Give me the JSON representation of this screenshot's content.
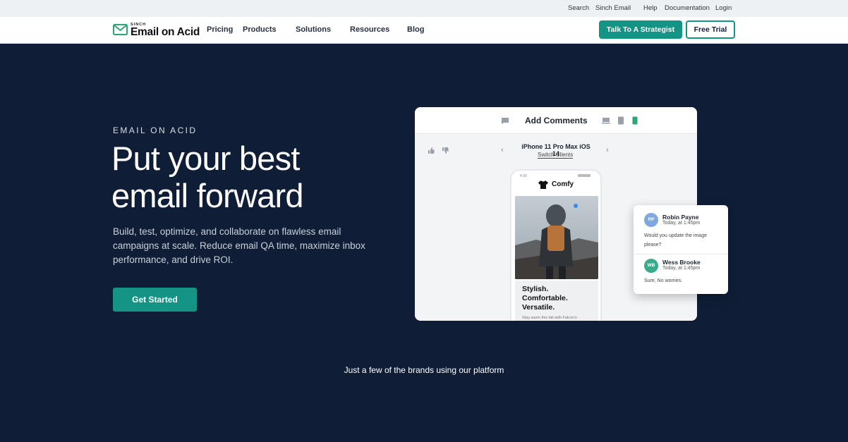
{
  "topbar": {
    "links": [
      "Search",
      "Sinch Email",
      "Help",
      "Documentation",
      "Login"
    ]
  },
  "nav": {
    "logo_small": "SINCH",
    "logo_text": "Email on Acid",
    "items": [
      "Pricing",
      "Products",
      "Solutions",
      "Resources",
      "Blog"
    ],
    "cta_primary": "Talk To A Strategist",
    "cta_secondary": "Free Trial"
  },
  "hero": {
    "eyebrow": "EMAIL ON ACID",
    "headline_line1": "Put your best",
    "headline_line2": "email forward",
    "subtext": "Build, test, optimize, and collaborate on flawless email campaigns at scale. Reduce email QA time, maximize inbox performance, and drive ROI.",
    "cta": "Get Started"
  },
  "mockup": {
    "title": "Add Comments",
    "device": "iPhone 11 Pro Max iOS 14",
    "switch_label": "Switch Clients",
    "phone": {
      "time": "4:30",
      "brand": "Comfy",
      "tagline": [
        "Stylish.",
        "Comfortable.",
        "Versatile."
      ],
      "fine_print": "Stay warm this fall with Falcon's"
    },
    "comments": [
      {
        "initials": "RP",
        "name": "Robin Payne",
        "time": "Today, at 1:45pm",
        "text": "Would you update the image please?",
        "color": "#7fa8e0"
      },
      {
        "initials": "WB",
        "name": "Wess Brooke",
        "time": "Today, at 1:45pm",
        "text": "Sure, No worries.",
        "color": "#3aaa8c"
      }
    ]
  },
  "brands_line": "Just a few of the brands using our platform",
  "colors": {
    "background": "#0f1e36",
    "accent": "#139484",
    "white": "#ffffff"
  }
}
